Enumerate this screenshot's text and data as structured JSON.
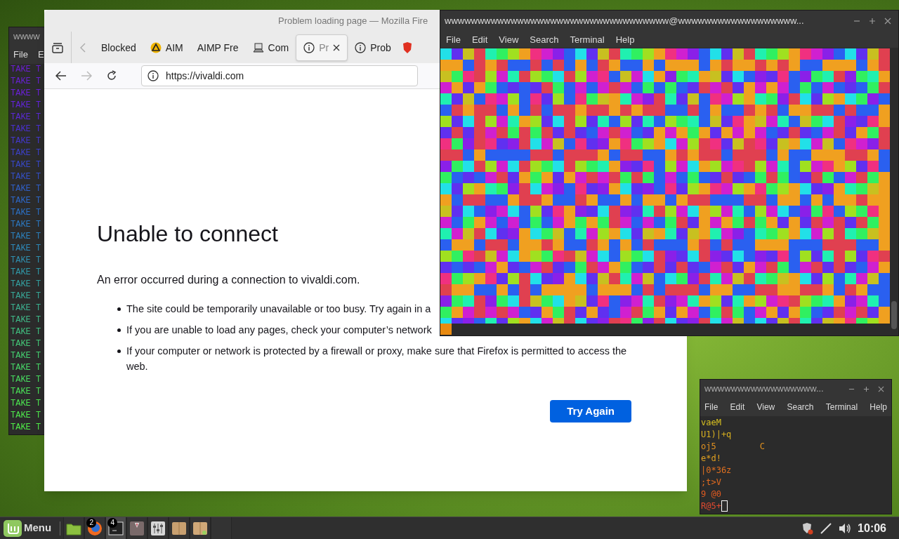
{
  "left_terminal": {
    "title": "wwww",
    "menu": [
      "File",
      "E"
    ],
    "lines": [
      {
        "text": "TAKE T",
        "color": "#6a1fd0"
      },
      {
        "text": "TAKE T",
        "color": "#6622d0"
      },
      {
        "text": "TAKE T",
        "color": "#6a20d8"
      },
      {
        "text": "TAKE T",
        "color": "#6224d8"
      },
      {
        "text": "TAKE T",
        "color": "#5a2ad4"
      },
      {
        "text": "TAKE T",
        "color": "#4a30d0"
      },
      {
        "text": "TAKE T",
        "color": "#4438cc"
      },
      {
        "text": "TAKE T",
        "color": "#3c40c8"
      },
      {
        "text": "TAKE T",
        "color": "#3848c8"
      },
      {
        "text": "TAKE T",
        "color": "#3450c8"
      },
      {
        "text": "TAKE T",
        "color": "#3060c8"
      },
      {
        "text": "TAKE T",
        "color": "#2e68c8"
      },
      {
        "text": "TAKE T",
        "color": "#2c70c4"
      },
      {
        "text": "TAKE T",
        "color": "#2c78c0"
      },
      {
        "text": "TAKE T",
        "color": "#2c80bc"
      },
      {
        "text": "TAKE T",
        "color": "#2e88b8"
      },
      {
        "text": "TAKE T",
        "color": "#3090b0"
      },
      {
        "text": "TAKE T",
        "color": "#3098a8"
      },
      {
        "text": "TAKE T",
        "color": "#34a0a0"
      },
      {
        "text": "TAKE T",
        "color": "#38a898"
      },
      {
        "text": "TAKE T",
        "color": "#3cb090"
      },
      {
        "text": "TAKE T",
        "color": "#40b888"
      },
      {
        "text": "TAKE T",
        "color": "#40c080"
      },
      {
        "text": "TAKE T",
        "color": "#44c878"
      },
      {
        "text": "TAKE T",
        "color": "#44d070"
      },
      {
        "text": "TAKE T",
        "color": "#48d868"
      },
      {
        "text": "TAKE T",
        "color": "#48dc60"
      },
      {
        "text": "TAKE T",
        "color": "#4ae058"
      },
      {
        "text": "TAKE T",
        "color": "#4ce450"
      },
      {
        "text": "TAKE T",
        "color": "#4ee84c"
      },
      {
        "text": "TAKE T",
        "color": "#50ec48"
      }
    ]
  },
  "browser": {
    "title": "Problem loading page — Mozilla Fire",
    "tabs": [
      {
        "label": "Blocked",
        "kind": "plain",
        "selected": false
      },
      {
        "label": "AIM",
        "kind": "aimp",
        "selected": false
      },
      {
        "label": "AIMP Fre",
        "kind": "plain",
        "selected": false
      },
      {
        "label": "Com",
        "kind": "computer",
        "selected": false
      },
      {
        "label": "Pr",
        "kind": "info",
        "selected": true
      },
      {
        "label": "Prob",
        "kind": "info",
        "selected": false
      }
    ],
    "url": "https://vivaldi.com",
    "heading": "Unable to connect",
    "intro": "An error occurred during a connection to vivaldi.com.",
    "bullets": [
      "The site could be temporarily unavailable or too busy. Try again in a",
      "If you are unable to load any pages, check your computer’s network",
      "If your computer or network is protected by a firewall or proxy, make sure that Firefox is permitted to access the web."
    ],
    "button": "Try Again"
  },
  "big_terminal": {
    "title": "wwwwwwwwwwwwwwwwwwwwwwwwwwwwwwwwww@wwwwwwwwwwwwwwwwww...",
    "menu": [
      "File",
      "Edit",
      "View",
      "Search",
      "Terminal",
      "Help"
    ]
  },
  "small_terminal": {
    "title": "wwwwwwwwwwwwwwwww...",
    "menu": [
      "File",
      "Edit",
      "View",
      "Search",
      "Terminal",
      "Help"
    ],
    "lines": [
      {
        "text": "vaeM",
        "color": "#d8c020"
      },
      {
        "text": "U1)|+q",
        "color": "#d8b020"
      },
      {
        "text": "oj5",
        "extra": "C",
        "color": "#e09020"
      },
      {
        "text": "e*d!",
        "color": "#e0a020"
      },
      {
        "text": "|0*36z",
        "color": "#e07020"
      },
      {
        "text": ";t>V",
        "color": "#e06a20"
      },
      {
        "text": "9 @0",
        "color": "#e05a20"
      },
      {
        "text": "R@5+",
        "color": "#e04a30",
        "cursor": true
      }
    ]
  },
  "taskbar": {
    "menu": "Menu",
    "apps": [
      {
        "kind": "folder"
      },
      {
        "kind": "firefox",
        "badge": "2"
      },
      {
        "kind": "terminal",
        "badge": "4",
        "selected": true
      },
      {
        "kind": "tie"
      },
      {
        "kind": "mixer"
      },
      {
        "kind": "box"
      },
      {
        "kind": "box2"
      },
      {
        "kind": "empty"
      }
    ],
    "clock": "10:06"
  }
}
